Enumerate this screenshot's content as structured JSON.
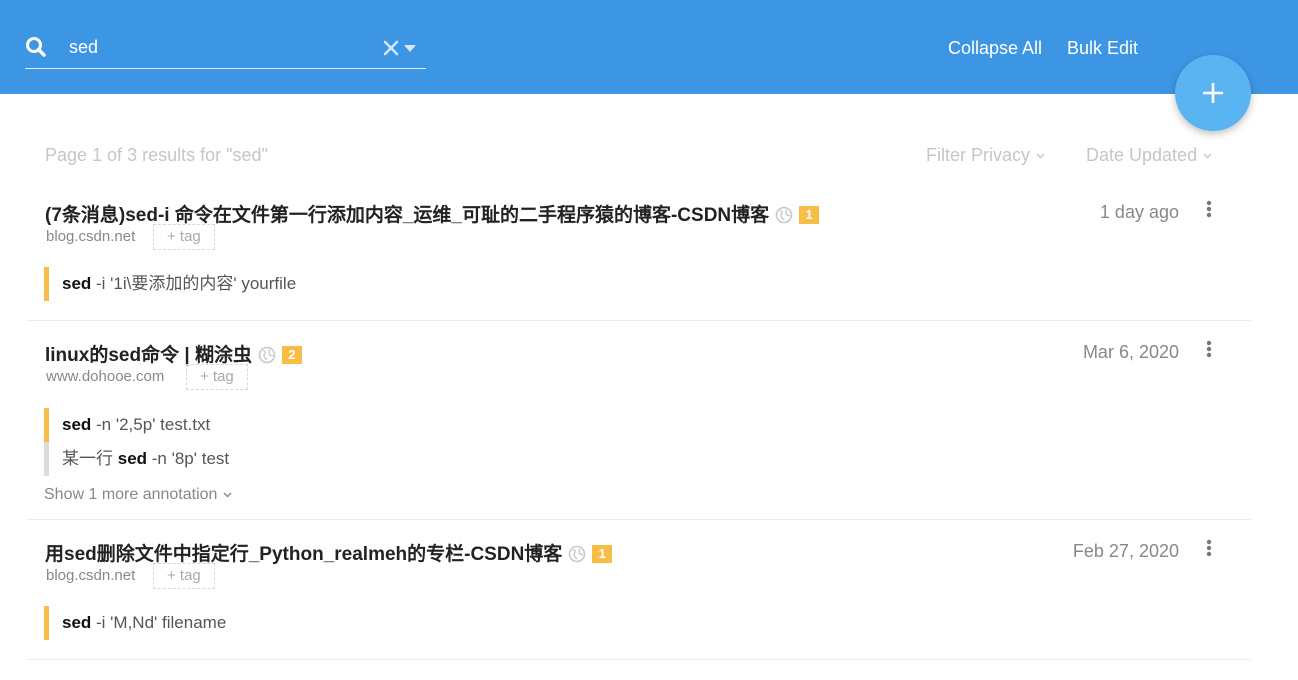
{
  "search": {
    "value": "sed",
    "placeholder": ""
  },
  "header": {
    "collapse_all": "Collapse All",
    "bulk_edit": "Bulk Edit",
    "fab_icon": "plus-icon"
  },
  "toolbar": {
    "results_info": "Page 1 of 3 results for \"sed\"",
    "filter_privacy": "Filter Privacy",
    "date_updated": "Date Updated"
  },
  "bookmarks": [
    {
      "title": "(7条消息)sed-i 命令在文件第一行添加内容_运维_可耻的二手程序猿的博客-CSDN博客",
      "badge": "1",
      "date": "1 day ago",
      "domain": "blog.csdn.net",
      "tag_label": "+ tag",
      "annotations": [
        {
          "keyword": "sed",
          "rest": " -i '1i\\要添加的内容' yourfile"
        }
      ]
    },
    {
      "title": "linux的sed命令 | 糊涂虫",
      "badge": "2",
      "date": "Mar 6, 2020",
      "domain": "www.dohooe.com",
      "tag_label": "+ tag",
      "annotations": [
        {
          "keyword": "sed",
          "rest": " -n '2,5p' test.txt"
        },
        {
          "prefix": "某一行 ",
          "keyword": "sed",
          "rest": " -n '8p' test"
        }
      ],
      "more_annotations": "Show 1 more annotation"
    },
    {
      "title": "用sed删除文件中指定行_Python_realmeh的专栏-CSDN博客",
      "badge": "1",
      "date": "Feb 27, 2020",
      "domain": "blog.csdn.net",
      "tag_label": "+ tag",
      "annotations": [
        {
          "keyword": "sed",
          "rest": " -i 'M,Nd' filename"
        }
      ]
    }
  ],
  "colors": {
    "header_bg": "#3d96e3",
    "fab_bg": "#5ab4f2",
    "badge": "#f6be47",
    "annotation_bar": "#f6be47"
  }
}
